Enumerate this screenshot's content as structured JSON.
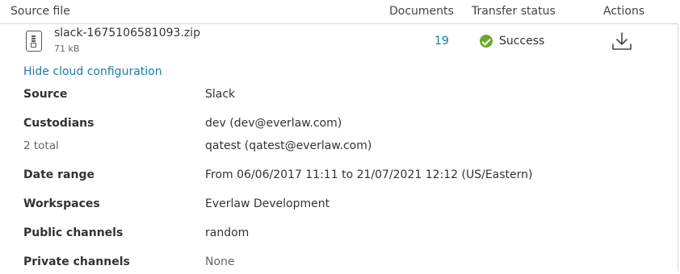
{
  "table": {
    "headers": {
      "source_file": "Source file",
      "documents": "Documents",
      "transfer_status": "Transfer status",
      "actions": "Actions"
    },
    "row": {
      "file_name": "slack-1675106581093.zip",
      "file_size": "71 kB",
      "file_icon": "zip-file-icon",
      "documents": "19",
      "status": "Success",
      "status_icon": "check-circle-icon",
      "status_color": "#6aaa2b",
      "action_icon": "download-icon"
    }
  },
  "cloud_config": {
    "toggle_label": "Hide cloud configuration",
    "source": {
      "label": "Source",
      "value": "Slack"
    },
    "custodians": {
      "label": "Custodians",
      "total": "2 total",
      "values": [
        "dev (dev@everlaw.com)",
        "qatest (qatest@everlaw.com)"
      ]
    },
    "date_range": {
      "label": "Date range",
      "value": "From 06/06/2017 11:11 to 21/07/2021 12:12 (US/Eastern)"
    },
    "workspaces": {
      "label": "Workspaces",
      "value": "Everlaw Development"
    },
    "public_channels": {
      "label": "Public channels",
      "value": "random"
    },
    "private_channels": {
      "label": "Private channels",
      "value": "None"
    }
  },
  "colors": {
    "link": "#1a7ca5",
    "success": "#6aaa2b",
    "divider": "#d6d6d6"
  }
}
